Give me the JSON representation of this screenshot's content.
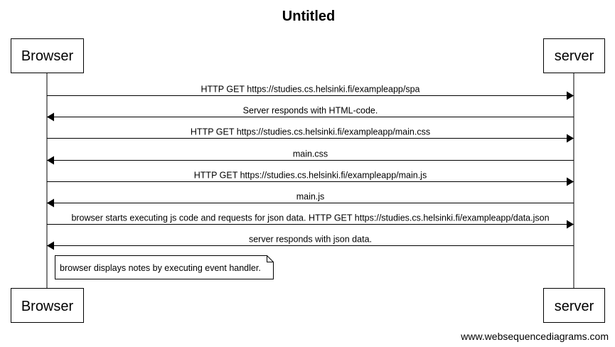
{
  "title": "Untitled",
  "participants": [
    {
      "id": "browser",
      "label": "Browser"
    },
    {
      "id": "server",
      "label": "server"
    }
  ],
  "messages": [
    {
      "from": "browser",
      "to": "server",
      "label": "HTTP GET https://studies.cs.helsinki.fi/exampleapp/spa"
    },
    {
      "from": "server",
      "to": "browser",
      "label": "Server responds with HTML-code."
    },
    {
      "from": "browser",
      "to": "server",
      "label": "HTTP GET https://studies.cs.helsinki.fi/exampleapp/main.css"
    },
    {
      "from": "server",
      "to": "browser",
      "label": "main.css"
    },
    {
      "from": "browser",
      "to": "server",
      "label": "HTTP GET https://studies.cs.helsinki.fi/exampleapp/main.js"
    },
    {
      "from": "server",
      "to": "browser",
      "label": "main.js"
    },
    {
      "from": "browser",
      "to": "server",
      "label": "browser starts executing js code and requests for json data. HTTP GET https://studies.cs.helsinki.fi/exampleapp/data.json"
    },
    {
      "from": "server",
      "to": "browser",
      "label": "server responds with json data."
    }
  ],
  "note": {
    "over": "browser",
    "label": "browser displays notes by executing event handler."
  },
  "footer": "www.websequencediagrams.com",
  "colors": {
    "line": "#000000",
    "box_fill": "#ffffff",
    "background": "#ffffff"
  }
}
